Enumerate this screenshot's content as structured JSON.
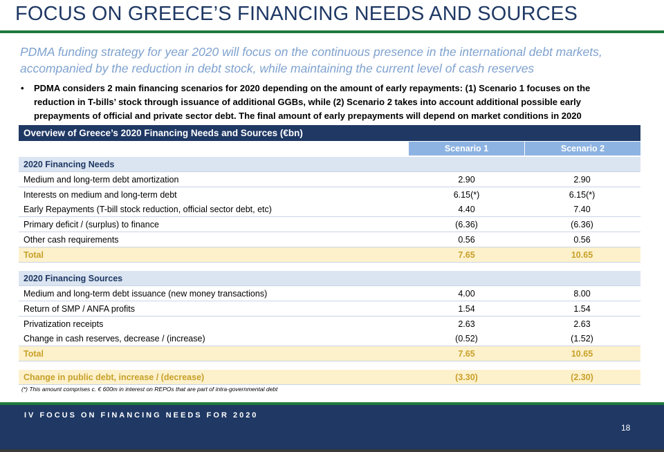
{
  "title": "FOCUS ON GREECE’S FINANCING NEEDS AND SOURCES",
  "subtitle_line1": "PDMA funding strategy for year 2020 will focus on the continuous presence in the international debt markets,",
  "subtitle_line2": "accompanied by the reduction in debt stock, while maintaining the current level of cash reserves",
  "bullet": {
    "marker": "•",
    "line1": "PDMA considers 2 main financing scenarios for 2020 depending on the amount of early repayments: (1) Scenario 1 focuses on the",
    "line2": "reduction in T-bills’ stock through issuance of additional GGBs, while (2) Scenario 2 takes into account additional possible early",
    "line3": "prepayments of official and private sector debt. The final amount of early prepayments will depend on market conditions in 2020"
  },
  "table": {
    "header": "Overview of Greece’s 2020 Financing Needs and Sources (€bn)",
    "col1": "Scenario 1",
    "col2": "Scenario 2",
    "rows": [
      {
        "label": "2020 Financing Needs",
        "v1": "",
        "v2": ""
      },
      {
        "label": "Medium and long-term debt amortization",
        "v1": "2.90",
        "v2": "2.90"
      },
      {
        "label": "Interests on medium and long-term debt",
        "v1": "6.15(*)",
        "v2": "6.15(*)"
      },
      {
        "label": "Early Repayments (T-bill stock reduction, official sector debt, etc)",
        "v1": "4.40",
        "v2": "7.40"
      },
      {
        "label": "Primary deficit / (surplus) to finance",
        "v1": "(6.36)",
        "v2": "(6.36)"
      },
      {
        "label": "Other cash requirements",
        "v1": "0.56",
        "v2": "0.56"
      },
      {
        "label": "Total",
        "v1": "7.65",
        "v2": "10.65"
      },
      {
        "label": "2020 Financing Sources",
        "v1": "",
        "v2": ""
      },
      {
        "label": "Medium and long-term debt issuance (new money transactions)",
        "v1": "4.00",
        "v2": "8.00"
      },
      {
        "label": "Return of SMP / ANFA profits",
        "v1": "1.54",
        "v2": "1.54"
      },
      {
        "label": "Privatization receipts",
        "v1": "2.63",
        "v2": "2.63"
      },
      {
        "label": "Change in cash reserves, decrease / (increase)",
        "v1": "(0.52)",
        "v2": "(1.52)"
      },
      {
        "label": "Total",
        "v1": "7.65",
        "v2": "10.65"
      },
      {
        "label": "Change in public debt, increase / (decrease)",
        "v1": "(3.30)",
        "v2": "(2.30)"
      }
    ]
  },
  "footnote": "(*) This amount comprises c. € 600m in interest on REPOs that are part of intra-governmental debt",
  "footer": {
    "section": "IV   FOCUS ON FINANCING NEEDS FOR 2020",
    "page": "18"
  },
  "colors": {
    "navy": "#1f3864",
    "green_rule": "#1f7a3c",
    "subtitle": "#7fa2cf",
    "scenario_header": "#8db3e2",
    "section_bg": "#dbe5f1",
    "total_bg": "#fdf1cc",
    "total_text": "#c8a028"
  }
}
